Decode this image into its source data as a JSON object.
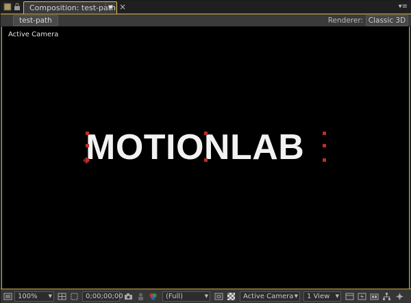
{
  "tabbar": {
    "tab_title": "Composition: test-path",
    "dropdown_glyph": "▼",
    "close_glyph": "×",
    "panel_menu_glyph": "▾≡"
  },
  "header": {
    "comp_name": "test-path",
    "renderer_label": "Renderer:",
    "renderer_value": "Classic 3D"
  },
  "viewer": {
    "camera_label": "Active Camera",
    "layer_text": "MOTIONLAB",
    "handle_color": "#b9302a"
  },
  "toolbar": {
    "zoom": "100%",
    "timecode": "0;00;00;00",
    "resolution": "(Full)",
    "view_camera": "Active Camera",
    "view_layout": "1 View",
    "dropdown_glyph": "▼"
  },
  "colors": {
    "accent": "#c9a648",
    "viewer_bg": "#000000",
    "panel_bg": "#333333"
  }
}
